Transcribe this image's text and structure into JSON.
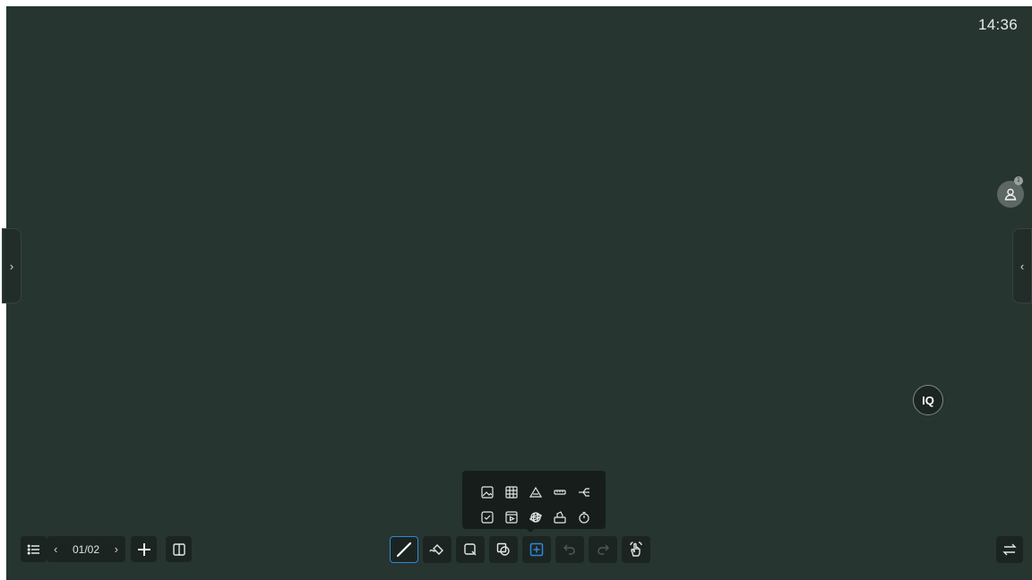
{
  "status": {
    "time": "14:36"
  },
  "presence": {
    "participant_count": "1"
  },
  "side_handles": {
    "left": "›",
    "right": "‹"
  },
  "iq_button": {
    "label": "IQ"
  },
  "pager": {
    "prev": "‹",
    "label": "01/02",
    "next": "›"
  },
  "toolbar_left": [
    "menu-icon",
    "add-page-icon",
    "page-overview-icon"
  ],
  "insert_popup": {
    "row1": [
      "image-icon",
      "table-icon",
      "geometry-icon",
      "ruler-icon",
      "mind-map-icon"
    ],
    "row2": [
      "quiz-icon",
      "media-icon",
      "globe-icon",
      "vote-icon",
      "timer-icon"
    ]
  },
  "toolbar_center": [
    "pen-icon",
    "eraser-icon",
    "select-icon",
    "shape-icon",
    "insert-icon",
    "undo-icon",
    "redo-icon",
    "gesture-icon"
  ],
  "toolbar_right": [
    "switch-icon"
  ],
  "colors": {
    "board": "#263530",
    "toolbar_bg": "#1c2422",
    "accent": "#2f87d8"
  }
}
